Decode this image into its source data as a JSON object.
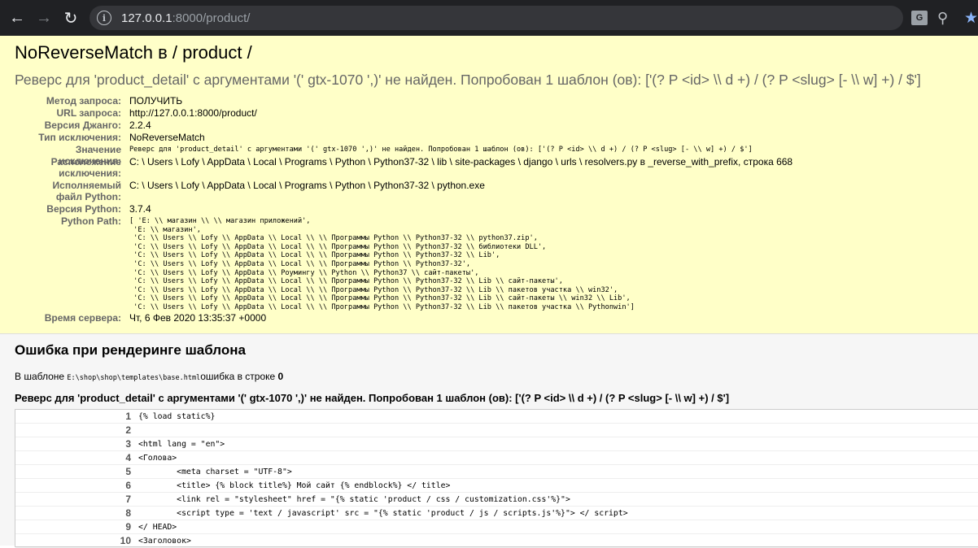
{
  "browser": {
    "url_host": "127.0.0.1",
    "url_rest": ":8000/product/"
  },
  "summary": {
    "title": "NoReverseMatch в / product /",
    "subtitle": "Реверс для 'product_detail' с аргументами '(' gtx-1070 ',)' не найден. Попробован 1 шаблон (ов): ['(? P <id> \\\\ d +) / (? P <slug> [- \\\\ w] +) / $']",
    "fields": [
      {
        "key": "Метод запроса:",
        "value": "ПОЛУЧИТЬ"
      },
      {
        "key": "URL запроса:",
        "value": "http://127.0.0.1:8000/product/"
      },
      {
        "key": "Версия Джанго:",
        "value": "2.2.4"
      },
      {
        "key": "Тип исключения:",
        "value": "NoReverseMatch"
      },
      {
        "key": "Значение исключения:",
        "value": "Реверс для 'product_detail' с аргументами '(' gtx-1070 ',)' не найден. Попробован 1 шаблон (ов): ['(? P <id> \\\\ d +) / (? P <slug> [- \\\\ w] +) / $']"
      },
      {
        "key": "Расположение исключения:",
        "value": "C: \\ Users \\ Lofy \\ AppData \\ Local \\ Programs \\ Python \\ Python37-32 \\ lib \\ site-packages \\ django \\ urls \\ resolvers.py в _reverse_with_prefix, строка 668"
      },
      {
        "key": "Исполняемый файл Python:",
        "value": "C: \\ Users \\ Lofy \\ AppData \\ Local \\ Programs \\ Python \\ Python37-32 \\ python.exe"
      },
      {
        "key": "Версия Python:",
        "value": "3.7.4"
      },
      {
        "key": "Python Path:",
        "value": "[ 'E: \\\\ магазин \\\\ \\\\ магазин приложений',\n 'E: \\\\ магазин',\n 'C: \\\\ Users \\\\ Lofy \\\\ AppData \\\\ Local \\\\ \\\\ Программы Python \\\\ Python37-32 \\\\ python37.zip',\n 'C: \\\\ Users \\\\ Lofy \\\\ AppData \\\\ Local \\\\ \\\\ Программы Python \\\\ Python37-32 \\\\ библиотеки DLL',\n 'C: \\\\ Users \\\\ Lofy \\\\ AppData \\\\ Local \\\\ \\\\ Программы Python \\\\ Python37-32 \\\\ Lib',\n 'C: \\\\ Users \\\\ Lofy \\\\ AppData \\\\ Local \\\\ \\\\ Программы Python \\\\ Python37-32',\n 'C: \\\\ Users \\\\ Lofy \\\\ AppData \\\\ Роумингу \\\\ Python \\\\ Python37 \\\\ сайт-пакеты',\n 'C: \\\\ Users \\\\ Lofy \\\\ AppData \\\\ Local \\\\ \\\\ Программы Python \\\\ Python37-32 \\\\ Lib \\\\ сайт-пакеты',\n 'C: \\\\ Users \\\\ Lofy \\\\ AppData \\\\ Local \\\\ \\\\ Программы Python \\\\ Python37-32 \\\\ Lib \\\\ пакетов участка \\\\ win32',\n 'C: \\\\ Users \\\\ Lofy \\\\ AppData \\\\ Local \\\\ \\\\ Программы Python \\\\ Python37-32 \\\\ Lib \\\\ сайт-пакеты \\\\ win32 \\\\ Lib',\n 'C: \\\\ Users \\\\ Lofy \\\\ AppData \\\\ Local \\\\ \\\\ Программы Python \\\\ Python37-32 \\\\ Lib \\\\ пакетов участка \\\\ Pythonwin']"
      },
      {
        "key": "Время сервера:",
        "value": "Чт, 6 Фев 2020 13:35:37 +0000"
      }
    ]
  },
  "template_error": {
    "heading": "Ошибка при рендеринге шаблона",
    "in_template_prefix": "В шаблоне ",
    "template_path": "E:\\shop\\shop\\templates\\base.html",
    "in_template_suffix": "ошибка в строке ",
    "line_number": "0",
    "message": "Реверс для 'product_detail' с аргументами '(' gtx-1070 ',)' не найден. Попробован 1 шаблон (ов): ['(? P <id> \\\\ d +) / (? P <slug> [- \\\\ w] +) / $']",
    "source_lines": [
      {
        "num": "1",
        "code": "{% load static%}"
      },
      {
        "num": "2",
        "code": ""
      },
      {
        "num": "3",
        "code": "<html lang = \"en\">"
      },
      {
        "num": "4",
        "code": "<Голова>"
      },
      {
        "num": "5",
        "code": "        <meta charset = \"UTF-8\">"
      },
      {
        "num": "6",
        "code": "        <title> {% block title%} Мой сайт {% endblock%} </ title>"
      },
      {
        "num": "7",
        "code": "        <link rel = \"stylesheet\" href = \"{% static 'product / css / customization.css'%}\">"
      },
      {
        "num": "8",
        "code": "        <script type = 'text / javascript' src = \"{% static 'product / js / scripts.js'%}\"> </ script>"
      },
      {
        "num": "9",
        "code": "</ HEAD>"
      },
      {
        "num": "10",
        "code": "<Заголовок>"
      }
    ]
  }
}
